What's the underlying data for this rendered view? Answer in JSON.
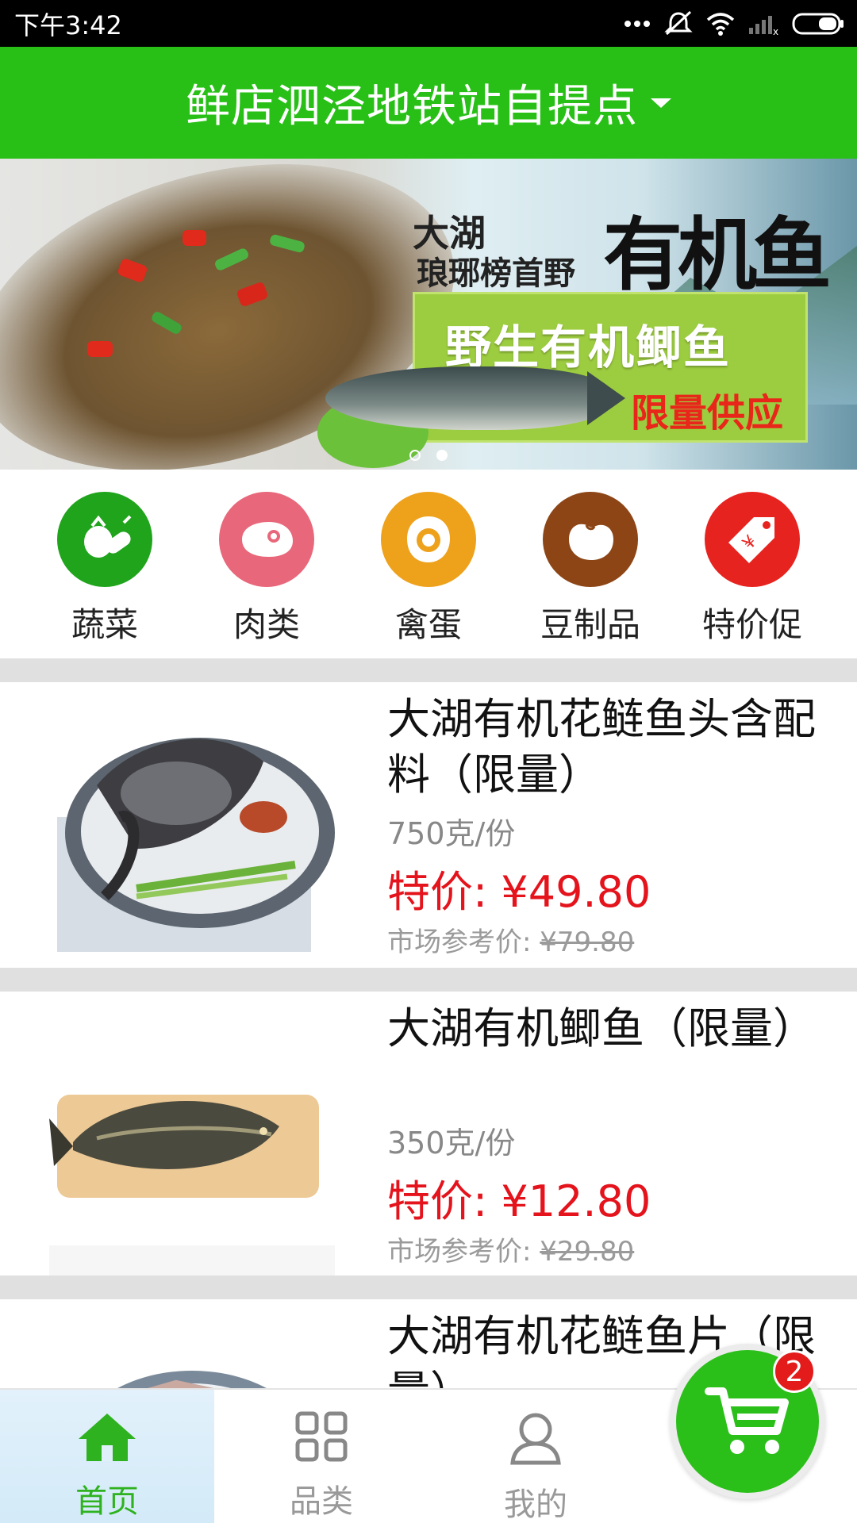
{
  "status_bar": {
    "time": "下午3:42",
    "icons": [
      "more-dots-icon",
      "vibrate-off-icon",
      "wifi-icon",
      "signal-icon",
      "battery-icon"
    ]
  },
  "header": {
    "title": "鲜店泗泾地铁站自提点",
    "dropdown_icon": "caret-down-icon",
    "bg_color": "#28c017"
  },
  "banner": {
    "line1": "大湖",
    "line2": "琅琊榜首野",
    "brush_text": "有机鱼",
    "promo_title": "野生有机鲫鱼",
    "promo_sub": "限量供应",
    "slides_count": 2,
    "active_slide": 2
  },
  "categories": [
    {
      "label": "蔬菜",
      "icon": "vegetable-icon",
      "color": "#1fa41c"
    },
    {
      "label": "肉类",
      "icon": "meat-icon",
      "color": "#e8677a"
    },
    {
      "label": "禽蛋",
      "icon": "egg-icon",
      "color": "#eea11b"
    },
    {
      "label": "豆制品",
      "icon": "bean-icon",
      "color": "#8d4516"
    },
    {
      "label": "特价促",
      "icon": "price-tag-icon",
      "color": "#e7231f"
    }
  ],
  "products": [
    {
      "name": "大湖有机花鲢鱼头含配料（限量）",
      "spec": "750克/份",
      "price_label": "特价: ¥49.80",
      "market_label": "市场参考价: ",
      "market_price": "¥79.80"
    },
    {
      "name": "大湖有机鲫鱼（限量）",
      "spec": "350克/份",
      "price_label": "特价: ¥12.80",
      "market_label": "市场参考价: ",
      "market_price": "¥29.80"
    },
    {
      "name": "大湖有机花鲢鱼片（限量）"
    }
  ],
  "bottom_nav": [
    {
      "label": "首页",
      "icon": "home-icon",
      "active": true
    },
    {
      "label": "品类",
      "icon": "grid-icon",
      "active": false
    },
    {
      "label": "我的",
      "icon": "user-icon",
      "active": false
    }
  ],
  "cart": {
    "icon": "cart-icon",
    "badge_count": "2"
  }
}
